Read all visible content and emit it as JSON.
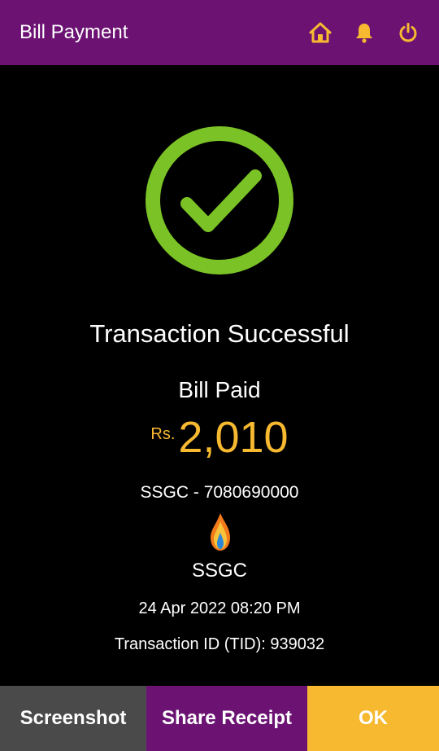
{
  "header": {
    "title": "Bill Payment",
    "icons": [
      "home-icon",
      "bell-icon",
      "power-icon"
    ]
  },
  "colors": {
    "header_bg": "#6b1273",
    "success_green": "#7ac226",
    "accent_yellow": "#f6b930",
    "screenshot_bg": "#4a4a4a"
  },
  "status": {
    "title": "Transaction Successful",
    "subtitle": "Bill Paid",
    "currency": "Rs.",
    "amount": "2,010"
  },
  "details": {
    "biller_line": "SSGC - 7080690000",
    "biller_name": "SSGC",
    "datetime": "24 Apr 2022 08:20 PM",
    "tid": "Transaction ID (TID): 939032"
  },
  "footer": {
    "screenshot_label": "Screenshot",
    "share_label": "Share Receipt",
    "ok_label": "OK"
  }
}
